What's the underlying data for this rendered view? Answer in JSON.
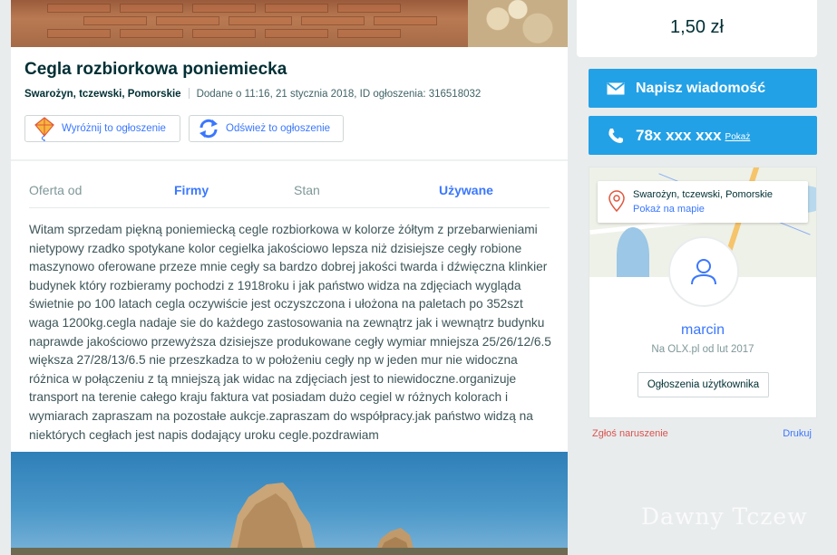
{
  "listing": {
    "title": "Cegla rozbiorkowa poniemiecka",
    "location": "Swarożyn, tczewski, Pomorskie",
    "added": "Dodane o 11:16, 21 stycznia 2018, ID ogłoszenia: 316518032",
    "promote_label": "Wyróżnij to ogłoszenie",
    "refresh_label": "Odśwież to ogłoszenie",
    "attributes": [
      {
        "key": "Oferta od",
        "value": "Firmy"
      },
      {
        "key": "Stan",
        "value": "Używane"
      }
    ],
    "description": "Witam sprzedam piękną poniemiecką cegle rozbiorkowa w kolorze żółtym z przebarwieniami nietypowy rzadko spotykane kolor cegielka jakościowo lepsza niż dzisiejsze cegły robione maszynowo oferowane przeze mnie cegły sa bardzo dobrej jakości twarda i dźwięczna klinkier budynek który rozbieramy pochodzi z 1918roku i jak państwo widza na zdjęciach wygląda świetnie po 100 latach cegla oczywiście jest oczyszczona i ułożona na paletach po 352szt waga 1200kg.cegla nadaje sie do każdego zastosowania na zewnątrz jak i wewnątrz budynku naprawde jakościowo przewyższa dzisiejsze produkowane cegły wymiar mniejsza 25/26/12/6.5 większa 27/28/13/6.5 nie przeszkadza to w położeniu cegły np w jeden mur nie widoczna różnica w połączeniu z tą mniejszą jak widac na zdjęciach jest to niewidoczne.organizuje transport na terenie całego kraju faktura vat posiadam dużo cegiel w różnych kolorach i wymiarach zapraszam na pozostałe aukcje.zapraszam do współpracy.jak państwo widzą na niektórych cegłach jest napis dodający uroku cegle.pozdrawiam"
  },
  "sidebar": {
    "price": "1,50 zł",
    "message_button": "Napisz wiadomość",
    "phone_masked": "78x xxx xxx",
    "phone_show": "Pokaż",
    "map_location": "Swarożyn, tczewski, Pomorskie",
    "map_link": "Pokaż na mapie",
    "user_name": "marcin",
    "user_since": "Na OLX.pl od lut 2017",
    "user_ads_button": "Ogłoszenia użytkownika",
    "report": "Zgłoś naruszenie",
    "print": "Drukuj"
  },
  "watermark": "Dawny Tczew",
  "colors": {
    "accent": "#23a1e6",
    "link": "#3a77ff",
    "text": "#002f34",
    "report": "#d9534f",
    "background": "#e9eced"
  }
}
